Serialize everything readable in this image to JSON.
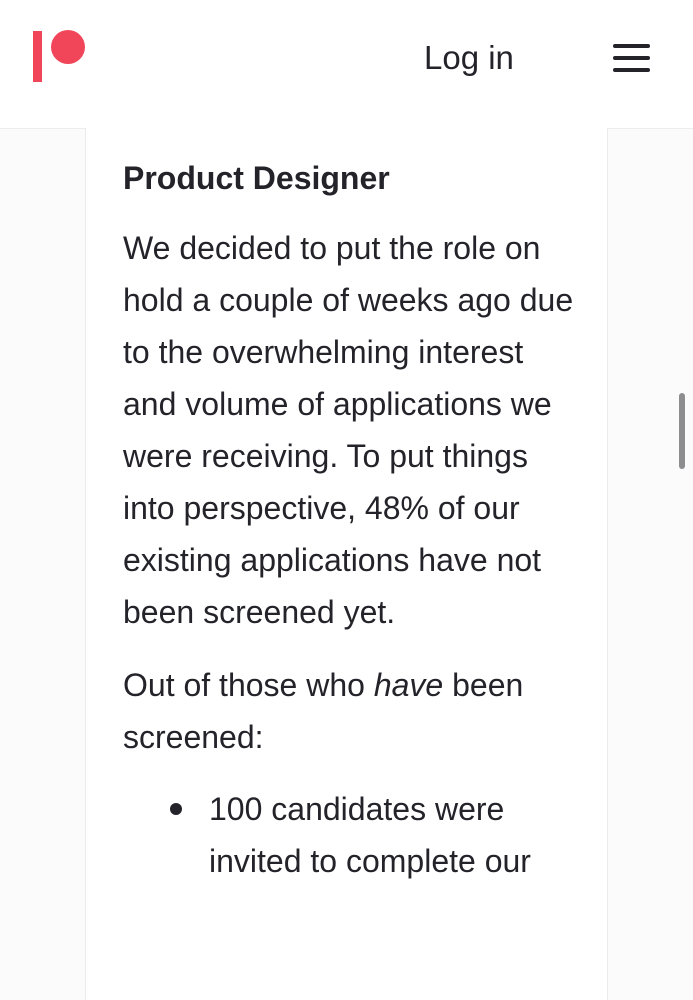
{
  "header": {
    "logo_label": "Patreon",
    "login_label": "Log in",
    "brand_color": "#f1465a"
  },
  "article": {
    "title": "Product Designer",
    "paragraph1": "We decided to put the role on hold a couple of weeks ago due to the overwhelming interest and volume of applications we were receiving. To put things into perspective, 48% of our existing applications have not been screened yet.",
    "paragraph2_before": "Out of those who ",
    "paragraph2_emphasis": "have",
    "paragraph2_after": " been screened:",
    "bullets": [
      "100 candidates were invited to complete our"
    ]
  }
}
